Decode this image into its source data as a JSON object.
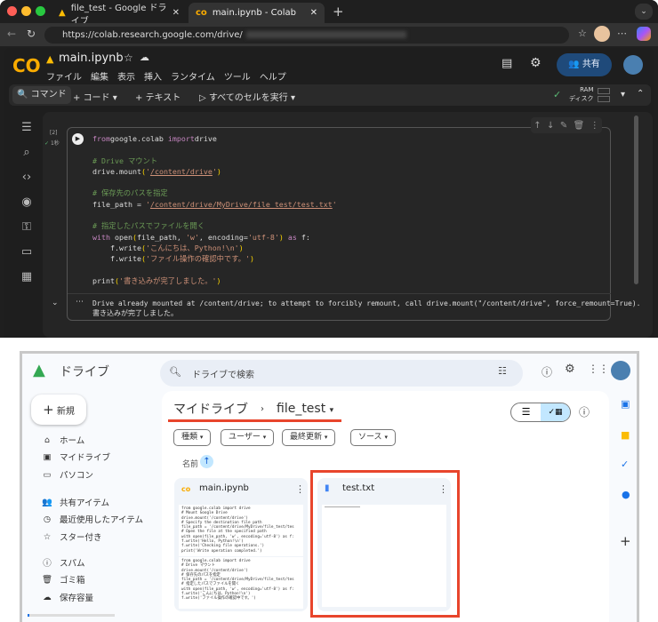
{
  "browser": {
    "tabs": [
      {
        "label": "file_test - Google ドライブ",
        "icon": "google-drive-icon"
      },
      {
        "label": "main.ipynb - Colab",
        "icon": "colab-icon"
      }
    ],
    "url": "https://colab.research.google.com/drive/"
  },
  "colab": {
    "title": "main.ipynb",
    "menu": [
      "ファイル",
      "編集",
      "表示",
      "挿入",
      "ランタイム",
      "ツール",
      "ヘルプ"
    ],
    "share_label": "共有",
    "toolbar": {
      "command": "コマンド",
      "code": "コード",
      "text": "テキスト",
      "run_all": "すべてのセルを実行",
      "ram": "RAM",
      "disk": "ディスク"
    },
    "cell": {
      "exec_count": "[2]",
      "exec_time": "1秒",
      "code": [
        [
          [
            "kw",
            "from"
          ],
          [
            "",
            "google.colab "
          ],
          [
            "kw",
            "import"
          ],
          [
            "",
            "drive"
          ]
        ],
        [],
        [
          [
            "cm",
            "# Drive マウント"
          ]
        ],
        [
          [
            "",
            "drive.mount"
          ],
          [
            "pn",
            "("
          ],
          [
            "st",
            "'"
          ],
          [
            "stu",
            "/content/drive"
          ],
          [
            "st",
            "'"
          ],
          [
            "pn",
            ")"
          ]
        ],
        [],
        [
          [
            "cm",
            "# 保存先のパスを指定"
          ]
        ],
        [
          [
            "",
            "file_path = "
          ],
          [
            "st",
            "'"
          ],
          [
            "stu",
            "/content/drive/MyDrive/file_test/test.txt"
          ],
          [
            "st",
            "'"
          ]
        ],
        [],
        [
          [
            "cm",
            "# 指定したパスでファイルを開く"
          ]
        ],
        [
          [
            "kw",
            "with "
          ],
          [
            "",
            "open"
          ],
          [
            "pn",
            "("
          ],
          [
            "",
            "file_path, "
          ],
          [
            "st",
            "'w'"
          ],
          [
            "",
            ", encoding="
          ],
          [
            "st",
            "'utf-8'"
          ],
          [
            "pn",
            ")"
          ],
          [
            "kw",
            " as "
          ],
          [
            "",
            "f:"
          ]
        ],
        [
          [
            "",
            "    f.write"
          ],
          [
            "pn",
            "("
          ],
          [
            "st",
            "'こんにちは、Python!\\n'"
          ],
          [
            "pn",
            ")"
          ]
        ],
        [
          [
            "",
            "    f.write"
          ],
          [
            "pn",
            "("
          ],
          [
            "st",
            "'ファイル操作の確認中です。'"
          ],
          [
            "pn",
            ")"
          ]
        ],
        [],
        [
          [
            "",
            "print"
          ],
          [
            "pn",
            "("
          ],
          [
            "st",
            "'書き込みが完了しました。'"
          ],
          [
            "pn",
            ")"
          ]
        ]
      ],
      "output": [
        "Drive already mounted at /content/drive; to attempt to forcibly remount, call drive.mount(\"/content/drive\", force_remount=True).",
        "書き込みが完了しました。"
      ]
    }
  },
  "drive": {
    "app_name": "ドライブ",
    "search_placeholder": "ドライブで検索",
    "new_label": "新規",
    "nav": [
      {
        "label": "ホーム",
        "icon": "home-icon"
      },
      {
        "label": "マイドライブ",
        "icon": "my-drive-icon"
      },
      {
        "label": "パソコン",
        "icon": "computer-icon"
      },
      {
        "label": "共有アイテム",
        "icon": "shared-icon"
      },
      {
        "label": "最近使用したアイテム",
        "icon": "clock-icon"
      },
      {
        "label": "スター付き",
        "icon": "star-icon"
      },
      {
        "label": "スパム",
        "icon": "spam-icon"
      },
      {
        "label": "ゴミ箱",
        "icon": "trash-icon"
      },
      {
        "label": "保存容量",
        "icon": "cloud-icon"
      }
    ],
    "breadcrumb": [
      "マイドライブ",
      "file_test"
    ],
    "filters": [
      "種類",
      "ユーザー",
      "最終更新",
      "ソース"
    ],
    "sort_label": "名前",
    "files": [
      {
        "name": "main.ipynb",
        "icon": "colab-icon",
        "preview": "from google.colab import drive\n# Mount Google Drive\ndrive.mount('/content/drive')\n# Specify the destination file path\nfile_path = '/content/drive/MyDrive/file_test/tes\n# Open the file at the specified path\nwith open(file_path, 'w', encoding='utf-8') as f:\nf.write('Hello, Python!\\n')\nf.write('Checking file operations.')\nprint('Write operation completed.')",
        "preview2": "from google.colab import drive\n# Drive マウント\ndrive.mount('/content/drive')\n# 保存先のパスを指定\nfile_path = '/content/drive/MyDrive/file_test/tes\n# 指定したパスでファイルを開く\nwith open(file_path, 'w', encoding='utf-8') as f:\nf.write('こんにちは、Python!\\n')\nf.write('ファイル操作の確認中です。')"
      },
      {
        "name": "test.txt",
        "icon": "doc-icon"
      }
    ],
    "highlight_color": "#e8452c"
  }
}
